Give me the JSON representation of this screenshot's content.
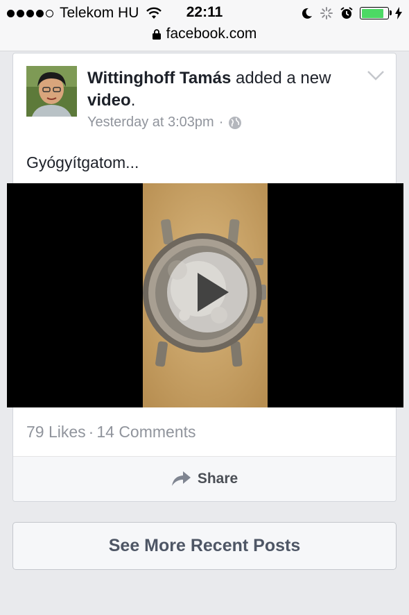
{
  "status_bar": {
    "carrier": "Telekom HU",
    "time": "22:11",
    "signal_bars_filled": 4,
    "signal_bars_total": 5,
    "battery_level": 0.85,
    "battery_color": "#4cd964"
  },
  "browser": {
    "url": "facebook.com"
  },
  "post": {
    "author": "Wittinghoff Tamás",
    "action_text": "added a new",
    "object_text": "video",
    "punctuation": ".",
    "timestamp": "Yesterday at 3:03pm",
    "separator": "·",
    "privacy_icon": "globe-icon",
    "text": "Gyógyítgatom...",
    "likes": "79 Likes",
    "comments": "14 Comments",
    "share_label": "Share"
  },
  "footer": {
    "see_more_label": "See More Recent Posts"
  },
  "colors": {
    "background": "#e9eaed",
    "meta_gray": "#90949c",
    "text_dark": "#1d2129"
  }
}
